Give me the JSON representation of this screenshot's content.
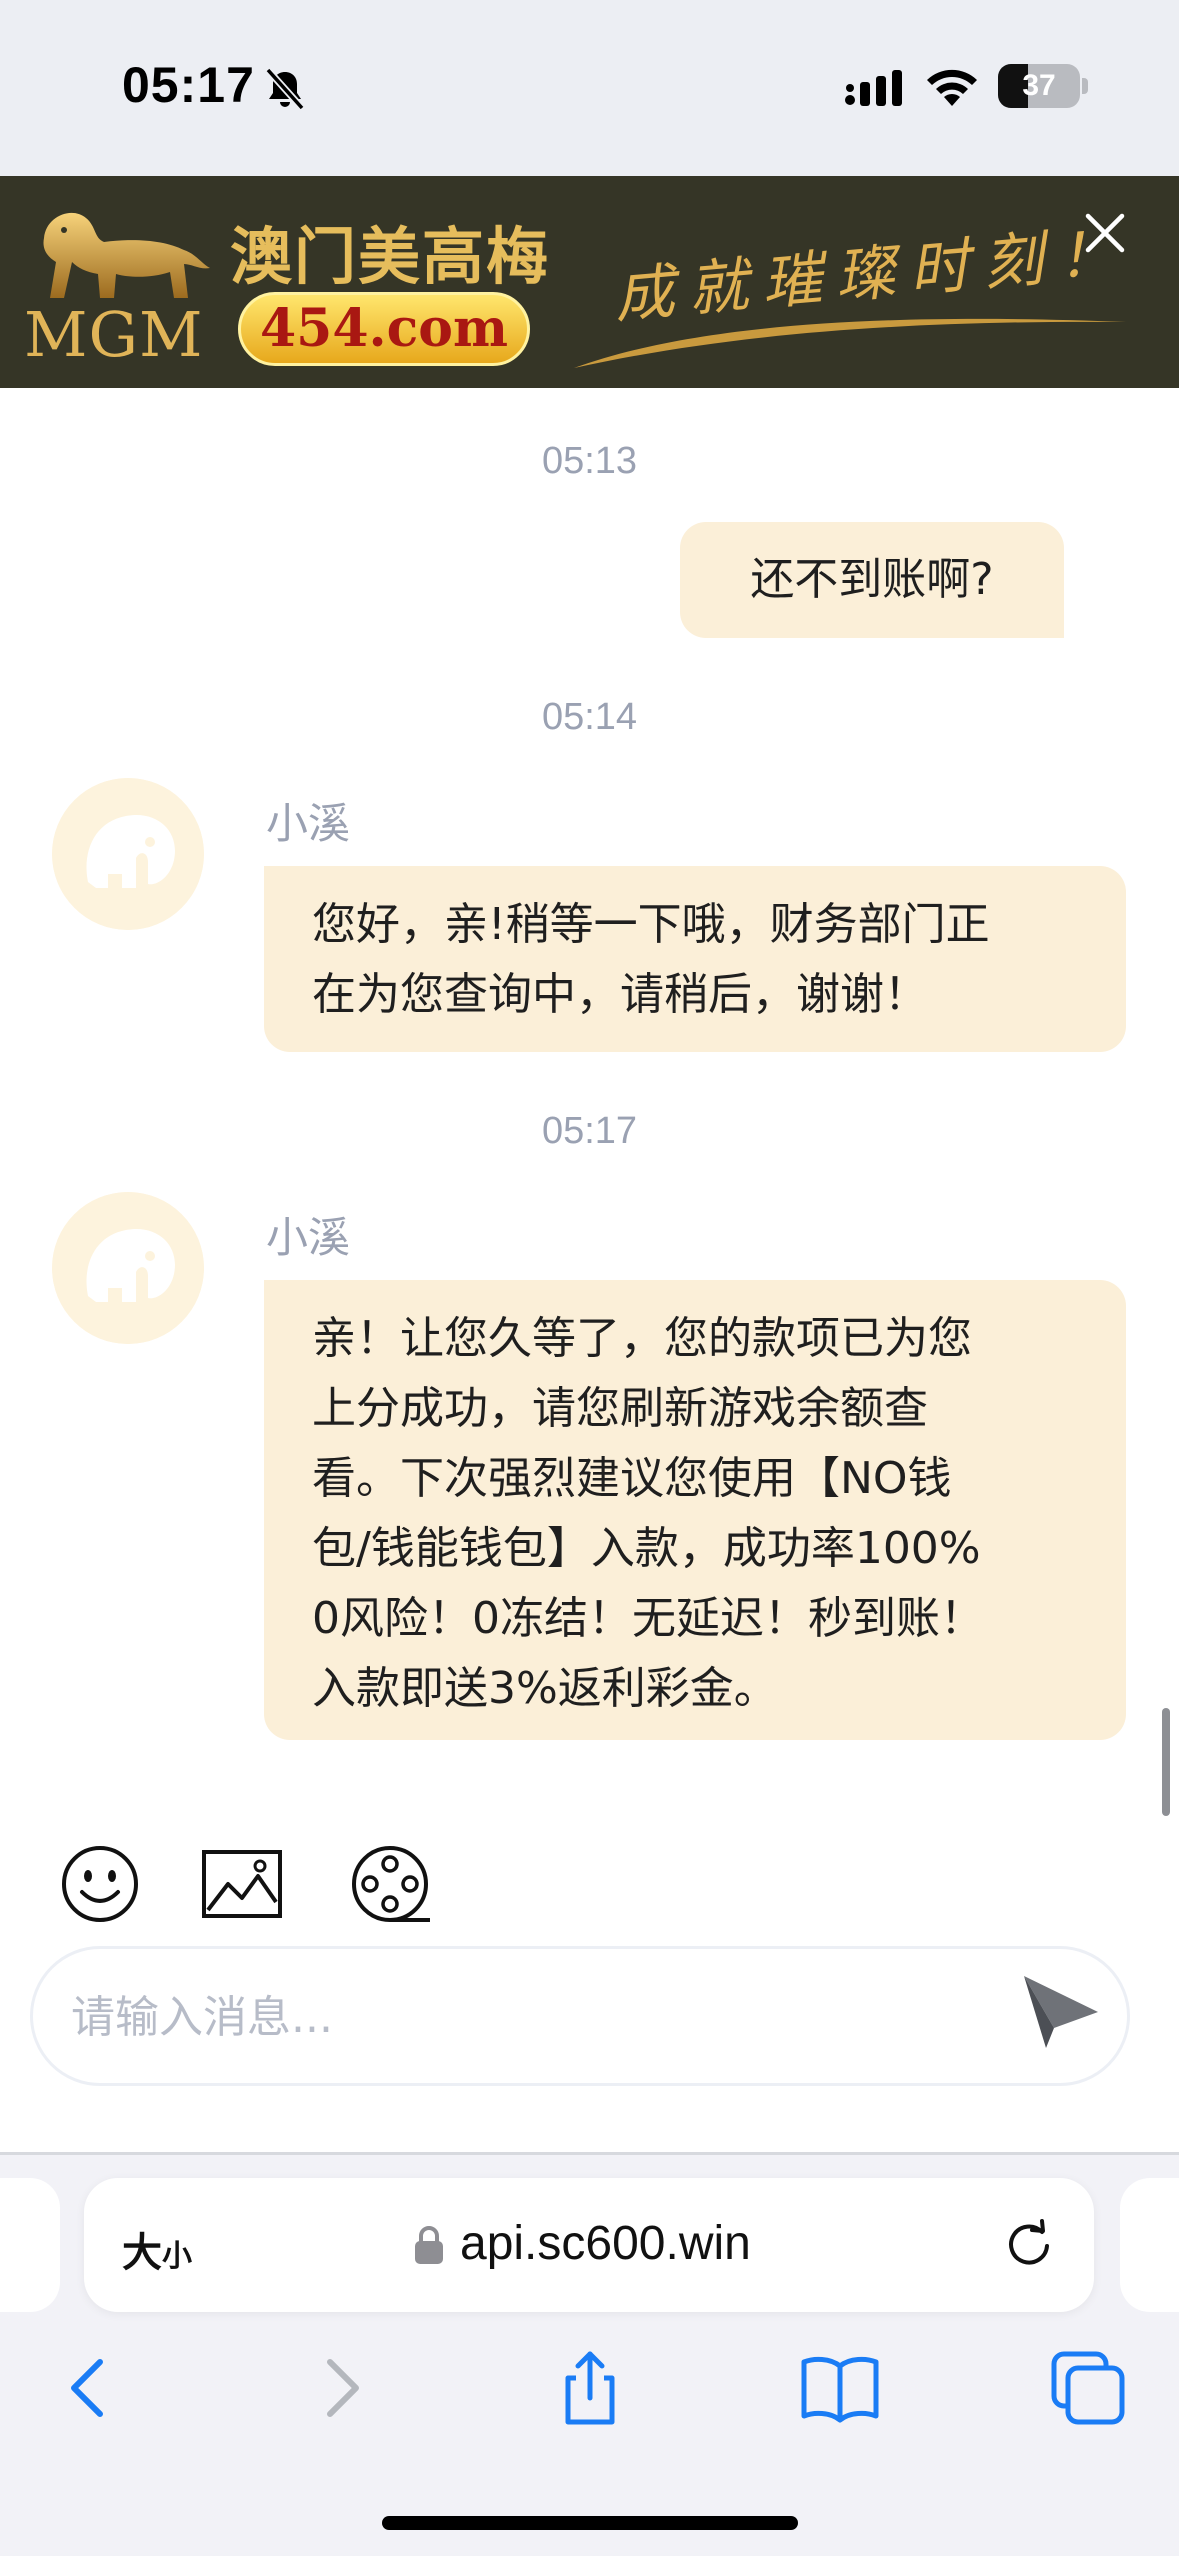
{
  "status_bar": {
    "time": "05:17",
    "battery_level": "37",
    "battery_fraction": 0.37,
    "icons": [
      "bell-slash-icon",
      "cellular-signal-icon",
      "wifi-icon",
      "battery-icon"
    ]
  },
  "banner_ad": {
    "logo_text": "MGM",
    "brand_cn": "澳门美高梅",
    "domain": "454.com",
    "slogan": "成就璀璨时刻！",
    "close_icon": "close-icon",
    "colors": {
      "background": "#353526",
      "gold": "#e0b152",
      "red": "#a91812"
    }
  },
  "chat": {
    "messages": [
      {
        "time": "05:13",
        "side": "right",
        "text": "还不到账啊?"
      },
      {
        "time": "05:14",
        "side": "left",
        "sender": "小溪",
        "lines": [
          "您好，亲!稍等一下哦，财务部门正",
          "在为您查询中，请稍后，谢谢！"
        ]
      },
      {
        "time": "05:17",
        "side": "left",
        "sender": "小溪",
        "lines": [
          "亲！让您久等了，您的款项已为您",
          "上分成功，请您刷新游戏余额查",
          "看。下次强烈建议您使用【NO钱",
          "包/钱能钱包】入款，成功率100%",
          "0风险！0冻结！无延迟！秒到账！",
          "入款即送3%返利彩金。"
        ]
      }
    ],
    "bubble_color": "#fbefd8",
    "avatar_icon": "elephant-icon"
  },
  "composer": {
    "tools": [
      "emoji-icon",
      "image-icon",
      "video-reel-icon"
    ],
    "placeholder": "请输入消息...",
    "send_icon": "send-icon"
  },
  "safari": {
    "text_size_label_big": "大",
    "text_size_label_small": "小",
    "url": "api.sc600.win",
    "nav_icons": [
      "back-icon",
      "forward-icon",
      "share-icon",
      "bookmarks-icon",
      "tabs-icon"
    ],
    "accent": "#1a7cf5"
  }
}
